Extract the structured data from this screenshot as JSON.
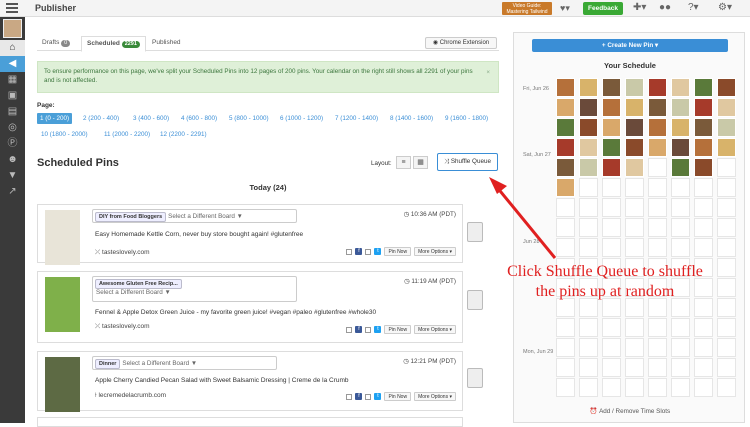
{
  "app": {
    "title": "Publisher"
  },
  "topbar": {
    "video_guide": "Video Guide: Mastering Tailwind",
    "feedback": "Feedback",
    "icons": [
      "heart-icon",
      "plus-icon",
      "chat-icon",
      "help-icon",
      "gear-icon"
    ]
  },
  "sidebar": {
    "icons": [
      "home-icon",
      "megaphone-icon",
      "insights-icon",
      "calendar-icon",
      "chart-icon",
      "instagram-icon",
      "pinterest-icon",
      "groups-icon",
      "filter-icon",
      "trend-icon"
    ]
  },
  "tabs": [
    {
      "label": "Drafts",
      "count": "0"
    },
    {
      "label": "Scheduled",
      "count": "2291"
    },
    {
      "label": "Published"
    }
  ],
  "chrome_ext": "Chrome Extension",
  "alert": "To ensure performance on this page, we've split your Scheduled Pins into 12 pages of 200 pins. Your calendar on the right still shows all 2291 of your pins and is not affected.",
  "pages": {
    "label": "Page:",
    "items": [
      "1 (0 - 200)",
      "2 (200 - 400)",
      "3 (400 - 600)",
      "4 (600 - 800)",
      "5 (800 - 1000)",
      "6 (1000 - 1200)",
      "7 (1200 - 1400)",
      "8 (1400 - 1600)",
      "9 (1600 - 1800)",
      "10 (1800 - 2000)",
      "11 (2000 - 2200)",
      "12 (2200 - 2291)"
    ]
  },
  "scheduled": {
    "heading": "Scheduled Pins",
    "layout_label": "Layout:",
    "shuffle": "Shuffle Queue",
    "today": "Today (24)"
  },
  "pins": [
    {
      "board": "DIY from Food Bloggers",
      "board_select": "Select a Different Board ▼",
      "time": "10:36 AM (PDT)",
      "desc": "Easy Homemade Kettle Corn, never buy store bought again! #glutenfree",
      "source": "tasteslovely.com"
    },
    {
      "board": "Awesome Gluten Free Recip...",
      "board_select": "Select a Different Board ▼",
      "time": "11:19 AM (PDT)",
      "desc": "Fennel & Apple Detox Green Juice - my favorite green juice! #vegan #paleo #glutenfree #whole30",
      "source": "tasteslovely.com"
    },
    {
      "board": "Dinner",
      "board_select": "Select a Different Board ▼",
      "time": "12:21 PM (PDT)",
      "desc": "Apple Cherry Candied Pecan Salad with Sweet Balsamic Dressing | Creme de la Crumb",
      "source": "lecremedelacrumb.com"
    }
  ],
  "pin_actions": {
    "pin_now": "Pin Now",
    "more": "More Options ▾"
  },
  "schedule": {
    "new_pin": "+ Create New Pin ▾",
    "title": "Your Schedule",
    "days": [
      "Fri, Jun 26",
      "Sat, Jun 27",
      "Jun 28",
      "Mon, Jun 29"
    ],
    "add_remove": "Add / Remove Time Slots"
  },
  "annotation": "Click Shuffle Queue to shuffle the pins up at random"
}
